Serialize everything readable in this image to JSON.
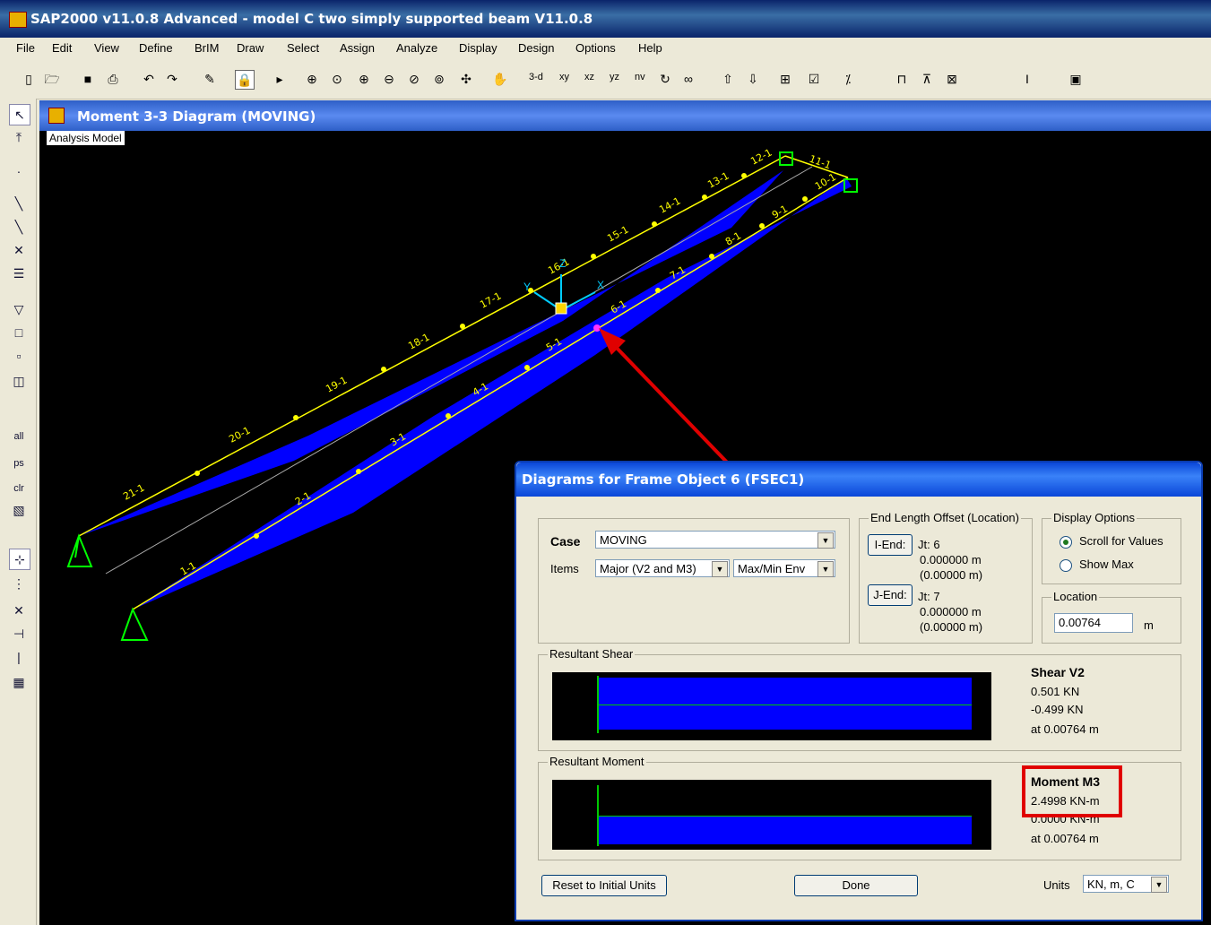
{
  "app": {
    "title": "SAP2000 v11.0.8 Advanced  - model C two simply supported beam V11.0.8"
  },
  "menu": [
    "File",
    "Edit",
    "View",
    "Define",
    "BrIM",
    "Draw",
    "Select",
    "Assign",
    "Analyze",
    "Display",
    "Design",
    "Options",
    "Help"
  ],
  "toolbar": {
    "view_buttons": [
      "3-d",
      "xy",
      "xz",
      "yz",
      "nv"
    ]
  },
  "left_toolbar": {
    "labels": [
      "all",
      "ps",
      "clr"
    ]
  },
  "model_window": {
    "title": "Moment 3-3 Diagram   (MOVING)",
    "badge": "Analysis Model",
    "beam_labels_a": [
      "21-1",
      "20-1",
      "19-1",
      "18-1",
      "17-1",
      "16-1",
      "15-1",
      "14-1",
      "13-1",
      "12-1",
      "11-1"
    ],
    "beam_labels_b": [
      "1-1",
      "2-1",
      "3-1",
      "4-1",
      "5-1",
      "6-1",
      "7-1",
      "8-1",
      "9-1",
      "10-1"
    ],
    "axis_x": "X",
    "axis_y": "Y",
    "axis_z": "Z"
  },
  "dialog": {
    "title": "Diagrams for Frame Object 6  (FSEC1)",
    "case_label": "Case",
    "case_value": "MOVING",
    "items_label": "Items",
    "items_value": "Major (V2 and M3)",
    "env_value": "Max/Min Env",
    "end_offset": {
      "title": "End Length Offset (Location)",
      "i_end_button": "I-End:",
      "i_jt": "Jt:  6",
      "i_val1": "0.000000 m",
      "i_val2": "(0.00000 m)",
      "j_end_button": "J-End:",
      "j_jt": "Jt:  7",
      "j_val1": "0.000000 m",
      "j_val2": "(0.00000 m)"
    },
    "display_options": {
      "title": "Display Options",
      "opt1": "Scroll for Values",
      "opt2": "Show Max"
    },
    "location": {
      "title": "Location",
      "value": "0.00764",
      "unit": "m"
    },
    "shear": {
      "group": "Resultant Shear",
      "title": "Shear V2",
      "max": "0.501 KN",
      "min": "-0.499 KN",
      "at": "at 0.00764 m"
    },
    "moment": {
      "group": "Resultant Moment",
      "title": "Moment M3",
      "max": "2.4998 KN-m",
      "min": "0.0000 KN-m",
      "at": "at 0.00764 m"
    },
    "reset_button": "Reset to Initial Units",
    "done_button": "Done",
    "units_label": "Units",
    "units_value": "KN, m, C"
  },
  "colors": {
    "diagram": "#0000ff",
    "annotation": "#e00000",
    "beam_line": "#ffff00",
    "support": "#00ff00"
  }
}
